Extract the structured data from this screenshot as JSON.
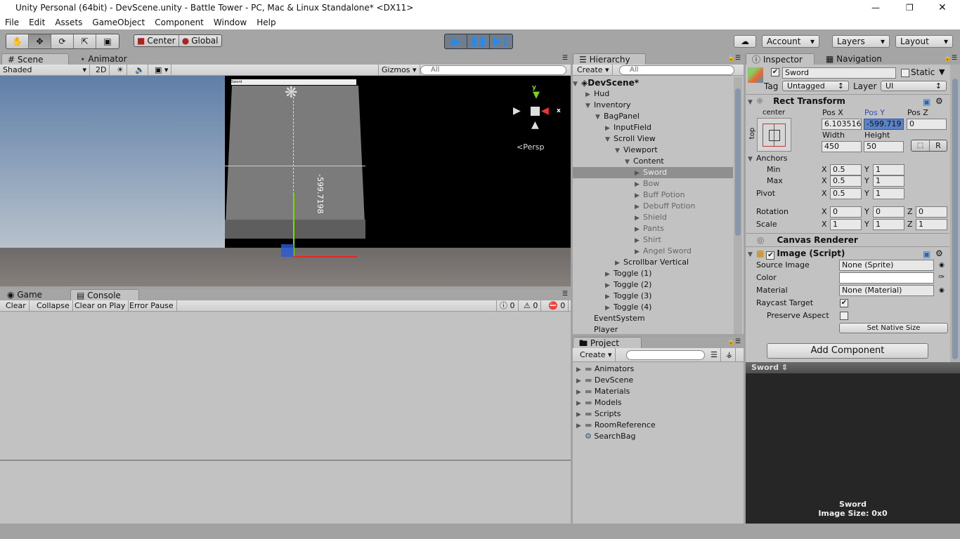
{
  "window": {
    "title": "Unity Personal (64bit) - DevScene.unity - Battle Tower - PC, Mac & Linux Standalone* <DX11>"
  },
  "menu": [
    "File",
    "Edit",
    "Assets",
    "GameObject",
    "Component",
    "Window",
    "Help"
  ],
  "toolbar": {
    "tools": [
      "hand-icon",
      "move-icon",
      "rotate-icon",
      "scale-icon",
      "rect-icon"
    ],
    "pivot": "Center",
    "space": "Global",
    "account": "Account",
    "layers": "Layers",
    "layout": "Layout"
  },
  "scene": {
    "tab": "Scene",
    "tab2": "Animator",
    "shading": "Shaded",
    "mode2d": "2D",
    "gizmos": "Gizmos",
    "search_placeholder": "All",
    "persp": "Persp",
    "pos_label": "-599.7198",
    "mini_label": "Sword"
  },
  "console": {
    "tab_game": "Game",
    "tab": "Console",
    "buttons": [
      "Clear",
      "Collapse",
      "Clear on Play",
      "Error Pause"
    ],
    "counts": [
      "0",
      "0",
      "0"
    ]
  },
  "hierarchy": {
    "tab": "Hierarchy",
    "create": "Create",
    "search_placeholder": "All",
    "scene": "DevScene*",
    "items": [
      {
        "label": "Hud",
        "level": 1,
        "arrow": "right"
      },
      {
        "label": "Inventory",
        "level": 1,
        "arrow": "down"
      },
      {
        "label": "BagPanel",
        "level": 2,
        "arrow": "down"
      },
      {
        "label": "InputField",
        "level": 3,
        "arrow": "right"
      },
      {
        "label": "Scroll View",
        "level": 3,
        "arrow": "down"
      },
      {
        "label": "Viewport",
        "level": 4,
        "arrow": "down"
      },
      {
        "label": "Content",
        "level": 5,
        "arrow": "down"
      },
      {
        "label": "Sword",
        "level": 6,
        "arrow": "right",
        "selected": true,
        "inactive": true
      },
      {
        "label": "Bow",
        "level": 6,
        "arrow": "right",
        "inactive": true
      },
      {
        "label": "Buff Potion",
        "level": 6,
        "arrow": "right",
        "inactive": true
      },
      {
        "label": "Debuff Potion",
        "level": 6,
        "arrow": "right",
        "inactive": true
      },
      {
        "label": "Shield",
        "level": 6,
        "arrow": "right",
        "inactive": true
      },
      {
        "label": "Pants",
        "level": 6,
        "arrow": "right",
        "inactive": true
      },
      {
        "label": "Shirt",
        "level": 6,
        "arrow": "right",
        "inactive": true
      },
      {
        "label": "Angel Sword",
        "level": 6,
        "arrow": "right",
        "inactive": true
      },
      {
        "label": "Scrollbar Vertical",
        "level": 4,
        "arrow": "right"
      },
      {
        "label": "Toggle (1)",
        "level": 3,
        "arrow": "right"
      },
      {
        "label": "Toggle (2)",
        "level": 3,
        "arrow": "right"
      },
      {
        "label": "Toggle (3)",
        "level": 3,
        "arrow": "right"
      },
      {
        "label": "Toggle (4)",
        "level": 3,
        "arrow": "right"
      },
      {
        "label": "EventSystem",
        "level": 1,
        "arrow": ""
      },
      {
        "label": "Player",
        "level": 1,
        "arrow": ""
      }
    ]
  },
  "project": {
    "tab": "Project",
    "create": "Create",
    "items": [
      {
        "label": "Animators",
        "icon": "folder-icon"
      },
      {
        "label": "DevScene",
        "icon": "folder-icon"
      },
      {
        "label": "Materials",
        "icon": "folder-icon"
      },
      {
        "label": "Models",
        "icon": "folder-icon"
      },
      {
        "label": "Scripts",
        "icon": "folder-icon"
      },
      {
        "label": "RoomReference",
        "icon": "folder-icon"
      },
      {
        "label": "SearchBag",
        "icon": "script-icon"
      }
    ]
  },
  "inspector": {
    "tab": "Inspector",
    "tab2": "Navigation",
    "name": "Sword",
    "static": "Static",
    "tag_label": "Tag",
    "tag": "Untagged",
    "layer_label": "Layer",
    "layer": "UI",
    "rect": {
      "title": "Rect Transform",
      "anchor_h": "center",
      "anchor_v": "top",
      "posx_l": "Pos X",
      "posy_l": "Pos Y",
      "posz_l": "Pos Z",
      "posx": "6.103516",
      "posy": "-599.719",
      "posz": "0",
      "width_l": "Width",
      "height_l": "Height",
      "width": "450",
      "height": "50",
      "r": "R",
      "anchors": "Anchors",
      "min": "Min",
      "max": "Max",
      "pivot": "Pivot",
      "min_x": "0.5",
      "min_y": "1",
      "max_x": "0.5",
      "max_y": "1",
      "pivot_x": "0.5",
      "pivot_y": "1",
      "rotation": "Rotation",
      "scale": "Scale",
      "rot": [
        "0",
        "0",
        "0"
      ],
      "scl": [
        "1",
        "1",
        "1"
      ],
      "x": "X",
      "y": "Y",
      "z": "Z"
    },
    "canvas_renderer": "Canvas Renderer",
    "image": {
      "title": "Image (Script)",
      "source_l": "Source Image",
      "source": "None (Sprite)",
      "color_l": "Color",
      "material_l": "Material",
      "material": "None (Material)",
      "raycast_l": "Raycast Target",
      "raycast": true,
      "preserve_l": "Preserve Aspect",
      "preserve": false,
      "native": "Set Native Size"
    },
    "add_component": "Add Component",
    "preview": {
      "title": "Sword",
      "name": "Sword",
      "size": "Image Size: 0x0"
    }
  }
}
